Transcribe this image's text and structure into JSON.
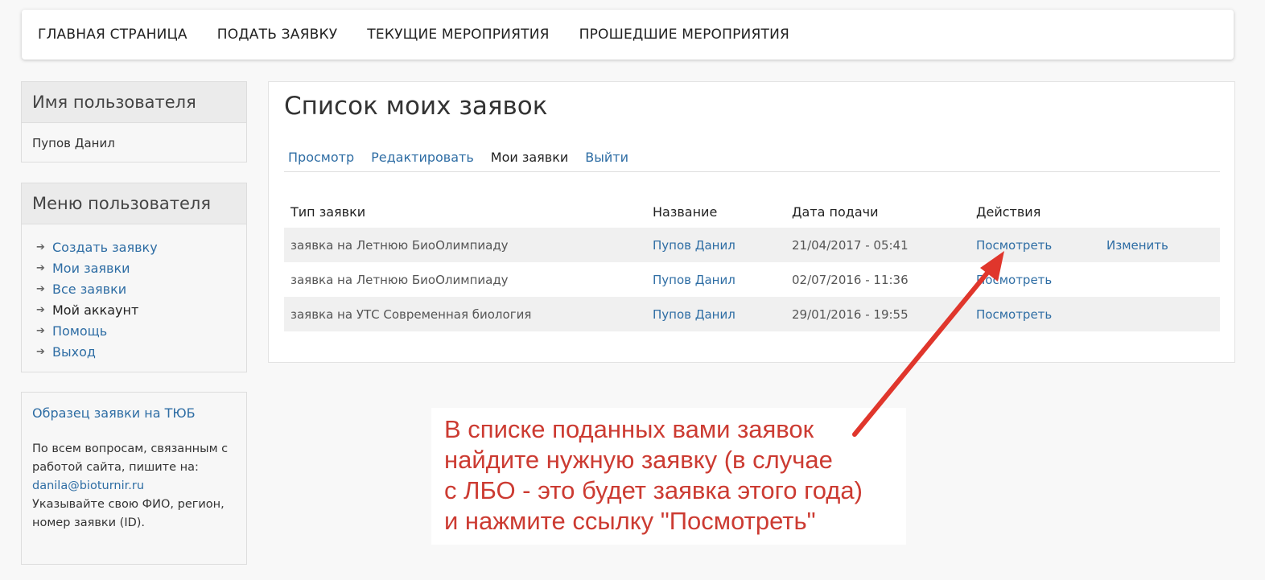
{
  "navbar": {
    "items": [
      "ГЛАВНАЯ СТРАНИЦА",
      "ПОДАТЬ ЗАЯВКУ",
      "ТЕКУЩИЕ МЕРОПРИЯТИЯ",
      "ПРОШЕДШИЕ МЕРОПРИЯТИЯ"
    ]
  },
  "sidebar": {
    "user_block": {
      "title": "Имя пользователя",
      "name": "Пупов Данил"
    },
    "menu_block": {
      "title": "Меню пользователя",
      "items": [
        "Создать заявку",
        "Мои заявки",
        "Все заявки",
        "Мой аккаунт",
        "Помощь",
        "Выход"
      ]
    },
    "info_block": {
      "title": "Образец заявки на ТЮБ",
      "text_lines": [
        "По всем вопросам, связанным с",
        "работой сайта, пишите на:"
      ],
      "email": "danila@bioturnir.ru",
      "text_lines_2": [
        "Указывайте свою ФИО, регион,",
        "номер заявки (ID)."
      ]
    }
  },
  "main": {
    "title": "Список моих заявок",
    "tabs": [
      "Просмотр",
      "Редактировать",
      "Мои заявки",
      "Выйти"
    ],
    "table": {
      "headers": [
        "Тип заявки",
        "Название",
        "Дата подачи",
        "Действия"
      ],
      "rows": [
        {
          "type": "заявка на Летнюю БиоОлимпиаду",
          "name": "Пупов Данил",
          "date": "21/04/2017 - 05:41",
          "view": "Посмотреть",
          "edit": "Изменить"
        },
        {
          "type": "заявка на Летнюю БиоОлимпиаду",
          "name": "Пупов Данил",
          "date": "02/07/2016 - 11:36",
          "view": "Посмотреть",
          "edit": ""
        },
        {
          "type": "заявка на УТС Современная биология",
          "name": "Пупов Данил",
          "date": "29/01/2016 - 19:55",
          "view": "Посмотреть",
          "edit": ""
        }
      ]
    }
  },
  "annotation": {
    "lines": [
      "В списке поданных вами заявок",
      "найдите нужную заявку (в случае",
      "с ЛБО - это будет заявка этого года)",
      "и нажмите ссылку \"Посмотреть\""
    ]
  },
  "colors": {
    "link": "#2e6da4",
    "annotation": "#cc3b32",
    "arrow": "#e0362c"
  }
}
